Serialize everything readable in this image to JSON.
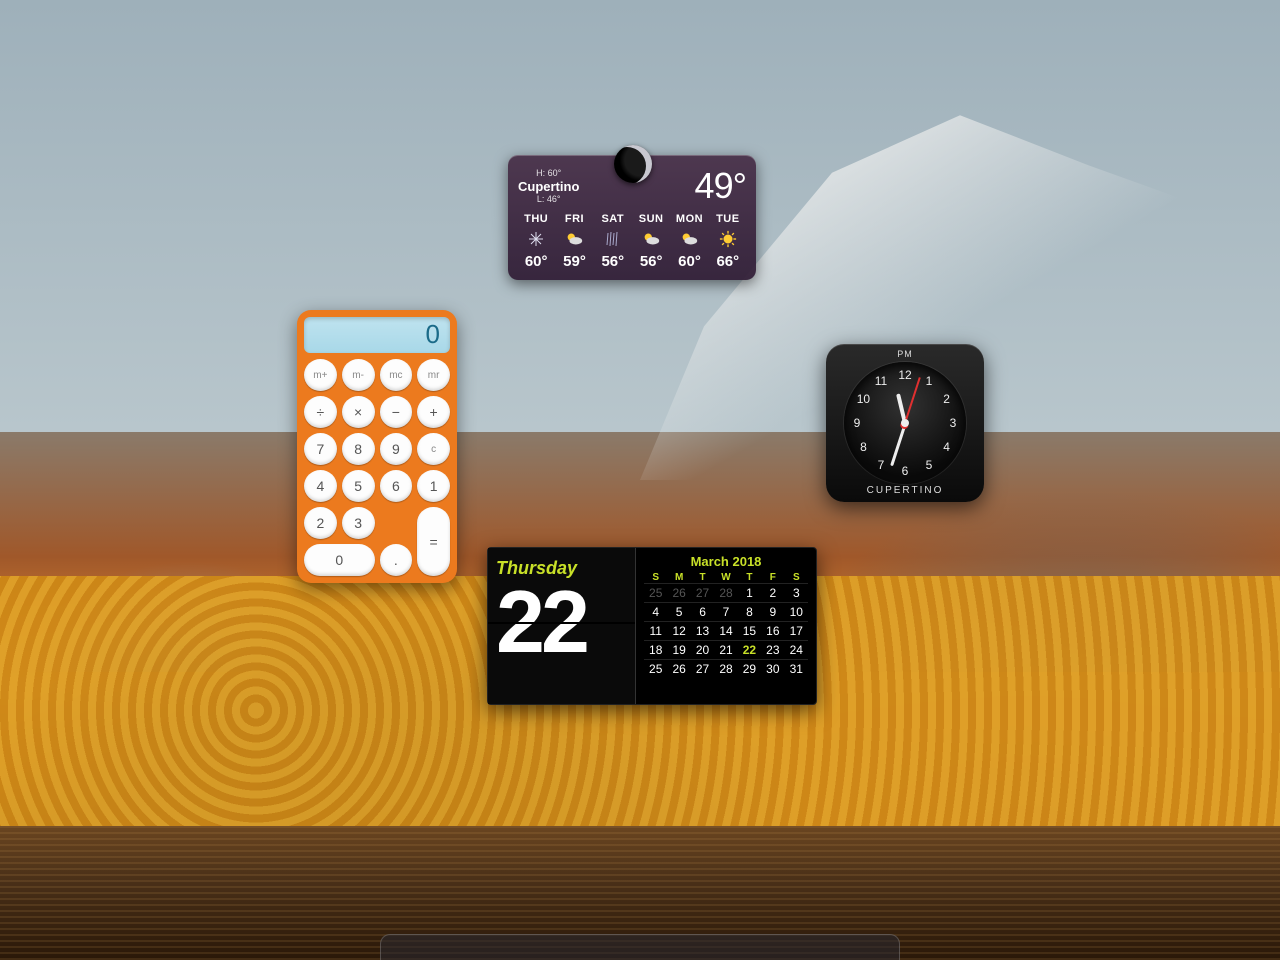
{
  "weather": {
    "location": "Cupertino",
    "high_label": "H: 60°",
    "low_label": "L: 46°",
    "current_temp": "49°",
    "days": [
      {
        "name": "THU",
        "icon": "snow",
        "temp": "60°"
      },
      {
        "name": "FRI",
        "icon": "partly-sunny",
        "temp": "59°"
      },
      {
        "name": "SAT",
        "icon": "rain",
        "temp": "56°"
      },
      {
        "name": "SUN",
        "icon": "partly-sunny",
        "temp": "56°"
      },
      {
        "name": "MON",
        "icon": "partly-sunny",
        "temp": "60°"
      },
      {
        "name": "TUE",
        "icon": "sunny",
        "temp": "66°"
      }
    ]
  },
  "calculator": {
    "display": "0",
    "buttons": [
      [
        "m+",
        "m-",
        "mc",
        "mr"
      ],
      [
        "÷",
        "×",
        "−",
        "+"
      ],
      [
        "7",
        "8",
        "9"
      ],
      [
        "4",
        "5",
        "6"
      ],
      [
        "1",
        "2",
        "3",
        "="
      ],
      [
        "0",
        ".",
        "c"
      ]
    ],
    "mem_row": [
      "m+",
      "m-",
      "mc",
      "mr"
    ],
    "op_row": [
      "÷",
      "×",
      "−",
      "+"
    ],
    "row_789": [
      "7",
      "8",
      "9"
    ],
    "row_456": [
      "4",
      "5",
      "6"
    ],
    "row_123": [
      "1",
      "2",
      "3"
    ],
    "equals": "=",
    "zero": "0",
    "dot": ".",
    "clear": "c"
  },
  "clock": {
    "ampm": "PM",
    "city": "CUPERTINO",
    "hour": 11,
    "minute": 33,
    "second": 3,
    "numbers": [
      "12",
      "1",
      "2",
      "3",
      "4",
      "5",
      "6",
      "7",
      "8",
      "9",
      "10",
      "11"
    ]
  },
  "calendar": {
    "day_name": "Thursday",
    "day_num": "22",
    "month_label": "March 2018",
    "weekday_heads": [
      "S",
      "M",
      "T",
      "W",
      "T",
      "F",
      "S"
    ],
    "weeks": [
      [
        {
          "n": "25",
          "o": true
        },
        {
          "n": "26",
          "o": true
        },
        {
          "n": "27",
          "o": true
        },
        {
          "n": "28",
          "o": true
        },
        {
          "n": "1"
        },
        {
          "n": "2"
        },
        {
          "n": "3"
        }
      ],
      [
        {
          "n": "4"
        },
        {
          "n": "5"
        },
        {
          "n": "6"
        },
        {
          "n": "7"
        },
        {
          "n": "8"
        },
        {
          "n": "9"
        },
        {
          "n": "10"
        }
      ],
      [
        {
          "n": "11"
        },
        {
          "n": "12"
        },
        {
          "n": "13"
        },
        {
          "n": "14"
        },
        {
          "n": "15"
        },
        {
          "n": "16"
        },
        {
          "n": "17"
        }
      ],
      [
        {
          "n": "18"
        },
        {
          "n": "19"
        },
        {
          "n": "20"
        },
        {
          "n": "21"
        },
        {
          "n": "22",
          "t": true
        },
        {
          "n": "23"
        },
        {
          "n": "24"
        }
      ],
      [
        {
          "n": "25"
        },
        {
          "n": "26"
        },
        {
          "n": "27"
        },
        {
          "n": "28"
        },
        {
          "n": "29"
        },
        {
          "n": "30"
        },
        {
          "n": "31"
        }
      ]
    ]
  }
}
